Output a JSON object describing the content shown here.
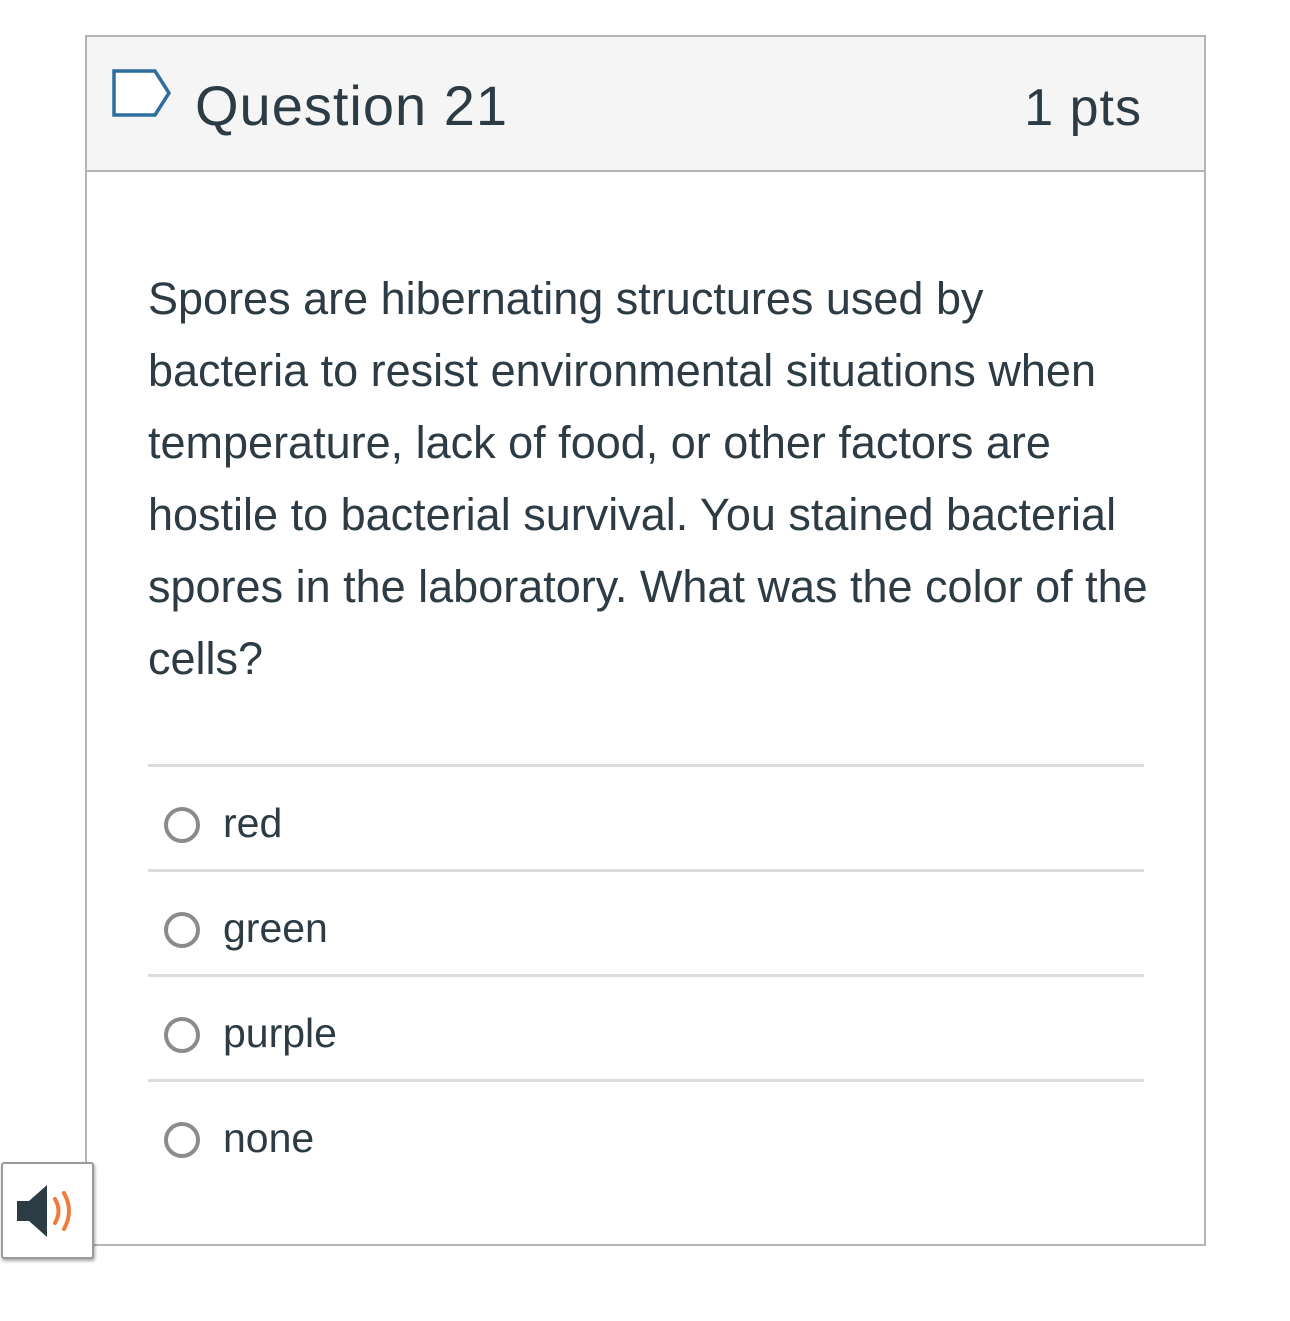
{
  "question": {
    "title": "Question 21",
    "points": "1 pts",
    "text": "Spores are hibernating structures used by bacteria to resist environmental situations when temperature, lack of food, or other factors are hostile to bacterial survival. You stained bacterial spores in the laboratory. What was the color of the cells?",
    "flag_icon": "flag-outline-icon"
  },
  "answers": [
    {
      "label": "red"
    },
    {
      "label": "green"
    },
    {
      "label": "purple"
    },
    {
      "label": "none"
    }
  ],
  "speaker": {
    "icon": "speaker-icon",
    "accent_color": "#f07b3f"
  },
  "colors": {
    "text": "#2d3b45",
    "header_bg": "#f5f5f5",
    "border": "#b4b4b4",
    "flag": "#2d6e9e"
  }
}
